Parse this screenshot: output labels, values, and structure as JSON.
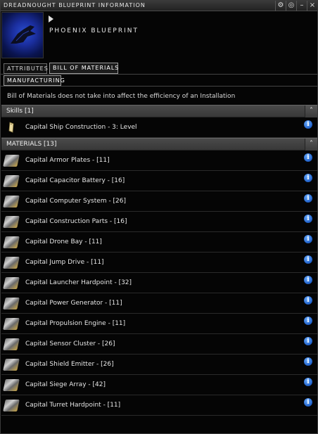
{
  "window": {
    "title": "DREADNOUGHT BLUEPRINT INFORMATION",
    "controls": [
      "⚙",
      "◎",
      "–",
      "×"
    ]
  },
  "header": {
    "blueprint_name": "PHOENIX BLUEPRINT"
  },
  "tabs": {
    "attributes": "ATTRIBUTES",
    "bill_of_materials": "BILL OF MATERIALS",
    "manufacturing": "MANUFACTURING"
  },
  "note": "Bill of Materials does not take into affect the efficiency of an Installation",
  "skills": {
    "header": "Skills [1]",
    "items": [
      {
        "label": "Capital Ship Construction - 3: Level"
      }
    ]
  },
  "materials": {
    "header": "MATERIALS [13]",
    "items": [
      {
        "label": "Capital Armor Plates - [11]"
      },
      {
        "label": "Capital Capacitor Battery - [16]"
      },
      {
        "label": "Capital Computer System - [26]"
      },
      {
        "label": "Capital Construction Parts - [16]"
      },
      {
        "label": "Capital Drone Bay - [11]"
      },
      {
        "label": "Capital Jump Drive - [11]"
      },
      {
        "label": "Capital Launcher Hardpoint - [32]"
      },
      {
        "label": "Capital Power Generator - [11]"
      },
      {
        "label": "Capital Propulsion Engine - [11]"
      },
      {
        "label": "Capital Sensor Cluster - [26]"
      },
      {
        "label": "Capital Shield Emitter - [26]"
      },
      {
        "label": "Capital Siege Array - [42]"
      },
      {
        "label": "Capital Turret Hardpoint - [11]"
      }
    ]
  },
  "info_glyph": "i",
  "collapse_glyph": "˄"
}
